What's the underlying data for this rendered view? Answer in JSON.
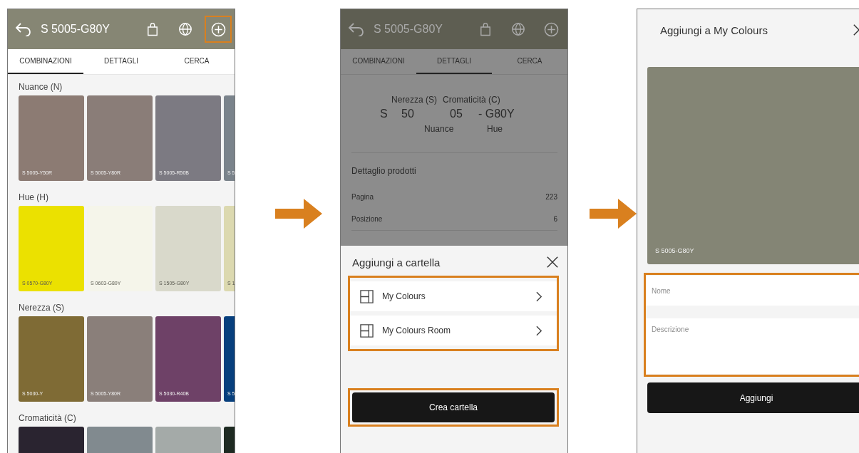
{
  "screens": [
    {
      "kind": "combinations",
      "title": "S 5005-G80Y",
      "actions": [
        {
          "kind": "bag",
          "highlighted": false
        },
        {
          "kind": "globe",
          "highlighted": false
        },
        {
          "kind": "add",
          "highlighted": true
        }
      ],
      "tabs": [
        {
          "label": "COMBINAZIONI",
          "selected": true
        },
        {
          "label": "DETTAGLI",
          "selected": false
        },
        {
          "label": "CERCA",
          "selected": false
        }
      ],
      "sections": [
        {
          "title": "Nuance (N)",
          "swatches": [
            {
              "code": "S 5005-Y50R",
              "color": "#8c7b73"
            },
            {
              "code": "S 5005-Y80R",
              "color": "#8a7d78"
            },
            {
              "code": "S 5005-R50B",
              "color": "#7c7a82"
            },
            {
              "code": "S 5",
              "color": "#7a838b"
            }
          ]
        },
        {
          "title": "Hue (H)",
          "swatches": [
            {
              "code": "S 0570-G80Y",
              "color": "#ebe100"
            },
            {
              "code": "S 0603-G80Y",
              "color": "#f5f5ea"
            },
            {
              "code": "S 1505-G80Y",
              "color": "#d9d9cb"
            },
            {
              "code": "S 1",
              "color": "#dcd9b0"
            }
          ]
        },
        {
          "title": "Nerezza (S)",
          "swatches": [
            {
              "code": "S 5030-Y",
              "color": "#7f6b35"
            },
            {
              "code": "S 5005-Y80R",
              "color": "#8a7f7a"
            },
            {
              "code": "S 5030-R40B",
              "color": "#6e4167"
            },
            {
              "code": "S 5",
              "color": "#073f7d"
            }
          ]
        },
        {
          "title": "Cromaticità (C)",
          "swatches": [
            {
              "color": "#2a2430"
            },
            {
              "color": "#818a8f"
            },
            {
              "color": "#a4aaa8"
            },
            {
              "color": "#1e2a22"
            }
          ]
        }
      ]
    },
    {
      "kind": "details",
      "title": "S 5005-G80Y",
      "actions": [
        {
          "kind": "bag",
          "highlighted": false
        },
        {
          "kind": "globe",
          "highlighted": false
        },
        {
          "kind": "add",
          "highlighted": false
        }
      ],
      "tabs": [
        {
          "label": "COMBINAZIONI",
          "selected": false
        },
        {
          "label": "DETTAGLI",
          "selected": true
        },
        {
          "label": "CERCA",
          "selected": false
        }
      ],
      "notation": {
        "labels": [
          "Nerezza (S)",
          "Cromaticità (C)"
        ],
        "values": [
          "S",
          "50",
          "05",
          "- G80Y"
        ],
        "sublabels": [
          "Nuance",
          "Hue"
        ]
      },
      "product_heading": "Dettaglio prodotti",
      "rows": [
        {
          "label": "Pagina",
          "value": "223"
        },
        {
          "label": "Posizione",
          "value": "6"
        }
      ],
      "sheet": {
        "title": "Aggiungi a cartella",
        "folders": [
          "My Colours",
          "My Colours Room"
        ],
        "folders_highlighted": true,
        "button": "Crea cartella",
        "button_highlighted": true
      }
    },
    {
      "kind": "add_form",
      "title": "Aggiungi a My Colours",
      "swatch": {
        "code": "S 5005-G80Y",
        "color": "#848575"
      },
      "fields": [
        {
          "placeholder": "Nome"
        },
        {
          "placeholder": "Descrizione"
        }
      ],
      "fields_highlighted": true,
      "button": "Aggiungi"
    }
  ]
}
